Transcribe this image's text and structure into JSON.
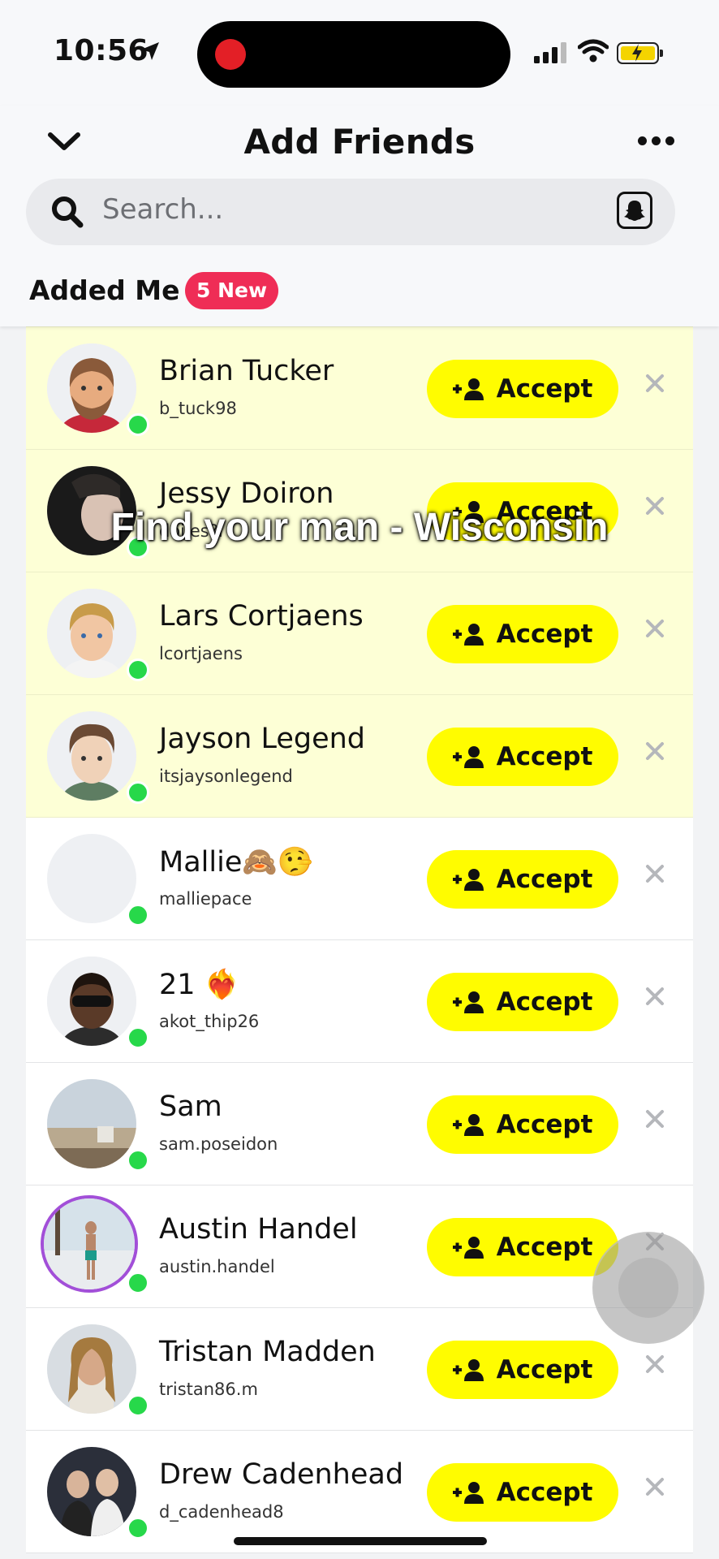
{
  "status_bar": {
    "time": "10:56",
    "location_icon": "location-arrow-icon",
    "signal_icon": "cellular-signal-icon",
    "wifi_icon": "wifi-icon",
    "battery_icon": "battery-charging-icon"
  },
  "header": {
    "title": "Add Friends",
    "back_icon": "chevron-down-icon",
    "more_icon": "more-horizontal-icon"
  },
  "search": {
    "placeholder": "Search...",
    "icon": "search-icon",
    "right_icon": "snapcode-icon"
  },
  "section": {
    "title": "Added Me",
    "badge": "5 New"
  },
  "accept_label": "Accept",
  "colors": {
    "accent": "#fffc00",
    "badge": "#ef2d56",
    "online": "#27d84a",
    "highlight_row": "#fdffd6",
    "story_ring": "#a24fd8"
  },
  "overlay_caption": "Find your man - Wisconsin",
  "requests": [
    {
      "name": "Brian Tucker",
      "username": "b_tuck98",
      "highlighted": true
    },
    {
      "name": "Jessy Doiron",
      "username": "doijes?l",
      "highlighted": true
    },
    {
      "name": "Lars Cortjaens",
      "username": "lcortjaens",
      "highlighted": true
    },
    {
      "name": "Jayson Legend",
      "username": "itsjaysonlegend",
      "highlighted": true
    },
    {
      "name": "Mallie🙈🤥",
      "username": "malliepace",
      "highlighted": false
    },
    {
      "name": "21 ❤️‍🔥",
      "username": "akot_thip26",
      "highlighted": false
    },
    {
      "name": "Sam",
      "username": "sam.poseidon",
      "highlighted": false
    },
    {
      "name": "Austin Handel",
      "username": "austin.handel",
      "highlighted": false
    },
    {
      "name": "Tristan Madden",
      "username": "tristan86.m",
      "highlighted": false
    },
    {
      "name": "Drew Cadenhead",
      "username": "d_cadenhead8",
      "highlighted": false
    }
  ]
}
